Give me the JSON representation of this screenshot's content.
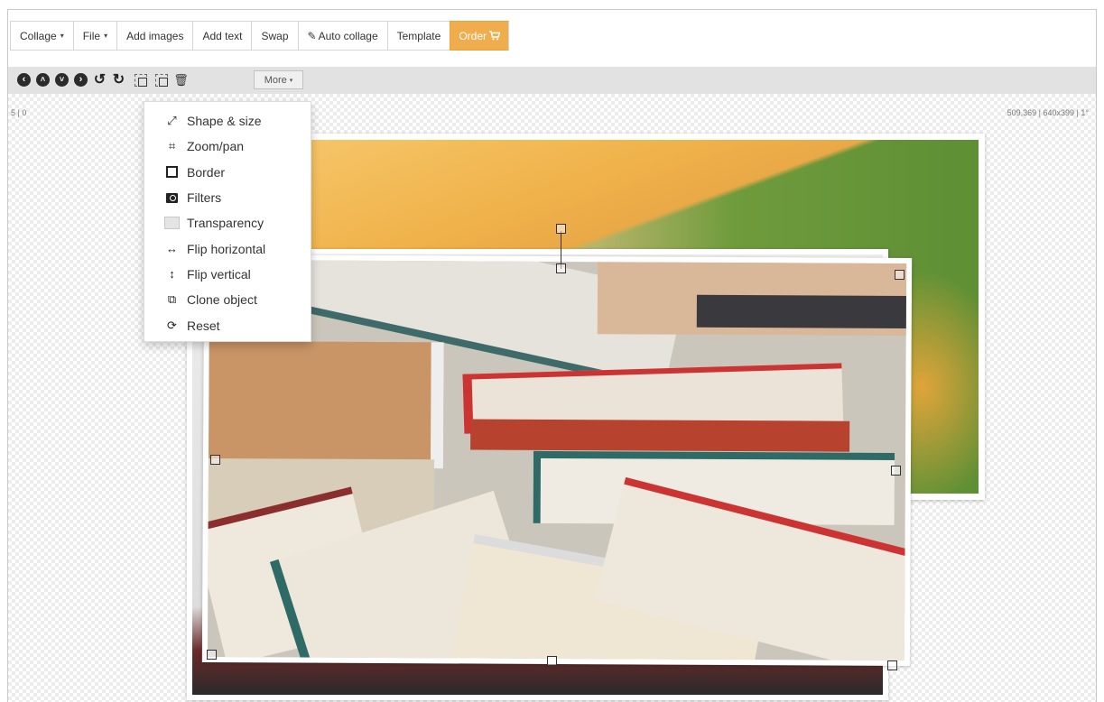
{
  "menu": {
    "collage": "Collage",
    "file": "File",
    "add_images": "Add images",
    "add_text": "Add text",
    "swap": "Swap",
    "auto_collage": "Auto collage",
    "template": "Template",
    "order": "Order",
    "caret": "▾",
    "accent_color": "#f0ad4e"
  },
  "toolbar": {
    "more_label": "More",
    "icons": [
      "arrow-left-icon",
      "arrow-up-icon",
      "arrow-down-icon",
      "arrow-right-icon",
      "rotate-left-icon",
      "rotate-right-icon",
      "bring-forward-icon",
      "send-backward-icon",
      "trash-icon"
    ]
  },
  "canvas": {
    "left_readout": "5 | 0",
    "right_readout": "509,369 | 640x399 | 1°"
  },
  "more_menu": {
    "items": [
      {
        "label": "Shape & size",
        "icon": "resize-icon"
      },
      {
        "label": "Zoom/pan",
        "icon": "crop-icon"
      },
      {
        "label": "Border",
        "icon": "border-icon"
      },
      {
        "label": "Filters",
        "icon": "camera-icon"
      },
      {
        "label": "Transparency",
        "icon": "transparency-icon"
      },
      {
        "label": "Flip horizontal",
        "icon": "flip-horizontal-icon"
      },
      {
        "label": "Flip vertical",
        "icon": "flip-vertical-icon"
      },
      {
        "label": "Clone object",
        "icon": "clone-icon"
      },
      {
        "label": "Reset",
        "icon": "refresh-icon"
      }
    ]
  }
}
